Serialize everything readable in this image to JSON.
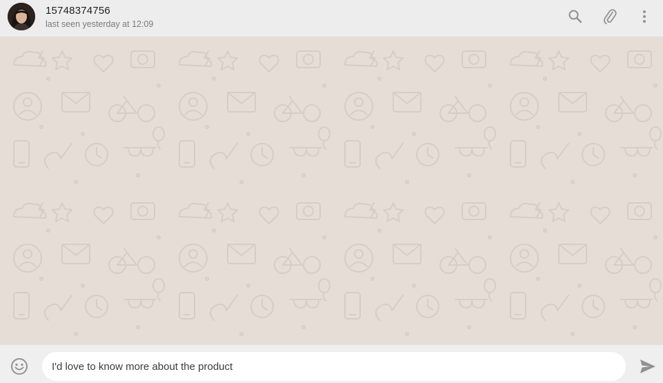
{
  "header": {
    "contact_name": "15748374756",
    "last_seen": "last seen yesterday at 12:09",
    "icons": [
      "search-icon",
      "paperclip-icon",
      "more-vertical-icon"
    ]
  },
  "composer": {
    "message_value": "I'd love to know more about the product",
    "emoji_icon": "smiley-icon",
    "send_icon": "send-icon"
  },
  "colors": {
    "header_bg": "#ededed",
    "chat_bg": "#e6ddd6",
    "footer_bg": "#efefef",
    "icon_gray": "#919191"
  }
}
